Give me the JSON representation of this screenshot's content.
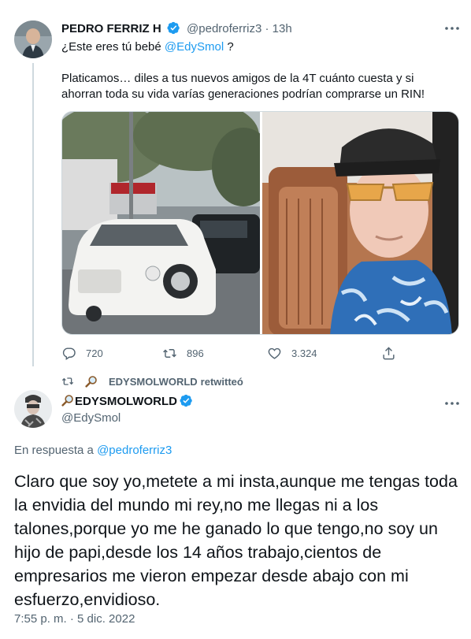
{
  "tweet": {
    "author_name": "PEDRO FERRIZ H",
    "handle": "@pedroferriz3",
    "separator": "·",
    "time": "13h",
    "text_prefix": "¿Este eres tú bebé ",
    "mention": "@EdySmol",
    "text_suffix": " ?",
    "text_body": "Platicamos… diles a tus nuevos amigos de la 4T cuánto cuesta y si ahorran toda su vida varías generaciones podrían comprarse un RIN!",
    "actions": {
      "replies": "720",
      "retweets": "896",
      "likes": "3.324"
    }
  },
  "retweet_context": {
    "retweeter": "EDYSMOLWORLD",
    "label": "retwitteó"
  },
  "reply_tweet": {
    "author_name": "EDYSMOLWORLD",
    "handle": "@EdySmol",
    "reply_label": "En respuesta a ",
    "reply_to": "@pedroferriz3",
    "text": "Claro que soy yo,metete a mi insta,aunque me tengas toda la envidia del mundo mi rey,no me llegas ni a los talones,porque yo me he ganado lo que tengo,no soy un hijo de papi,desde los 14 años trabajo,cientos de empresarios me vieron empezar desde abajo con mi esfuerzo,envidioso.",
    "timestamp": "7:55 p. m. · 5 dic. 2022"
  },
  "colors": {
    "accent": "#1d9bf0",
    "muted": "#536471",
    "text": "#0f1419",
    "border": "#cfd9de"
  },
  "icons": [
    "verified-badge-icon",
    "more-icon",
    "reply-icon",
    "retweet-icon",
    "like-icon",
    "share-icon",
    "magnifying-glass-icon"
  ]
}
